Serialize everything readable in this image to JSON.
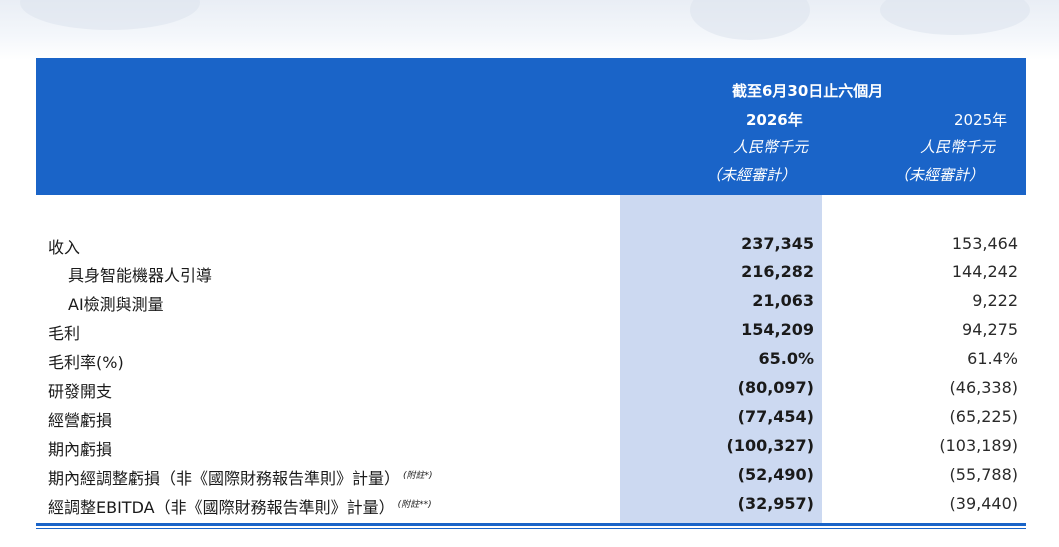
{
  "header": {
    "period": "截至6月30日止六個月",
    "col2026": {
      "year": "2026年",
      "currency": "人民幣千元",
      "audit": "（未經審計）"
    },
    "col2025": {
      "year": "2025年",
      "currency": "人民幣千元",
      "audit": "（未經審計）"
    }
  },
  "rows": [
    {
      "label": "收入",
      "v2026": "237,345",
      "v2025": "153,464"
    },
    {
      "label": "具身智能機器人引導",
      "v2026": "216,282",
      "v2025": "144,242"
    },
    {
      "label": "AI檢測與測量",
      "v2026": "21,063",
      "v2025": "9,222"
    },
    {
      "label": "毛利",
      "v2026": "154,209",
      "v2025": "94,275"
    },
    {
      "label": "毛利率(%)",
      "v2026": "65.0%",
      "v2025": "61.4%"
    },
    {
      "label": "研發開支",
      "v2026": "(80,097)",
      "v2025": "(46,338)"
    },
    {
      "label": "經營虧損",
      "v2026": "(77,454)",
      "v2025": "(65,225)"
    },
    {
      "label": "期內虧損",
      "v2026": "(100,327)",
      "v2025": "(103,189)"
    },
    {
      "label": "期內經調整虧損（非《國際財務報告準則》計量）",
      "note": "(附註*)",
      "v2026": "(52,490)",
      "v2025": "(55,788)"
    },
    {
      "label": "經調整EBITDA（非《國際財務報告準則》計量）",
      "note": "(附註**)",
      "v2026": "(32,957)",
      "v2025": "(39,440)"
    }
  ]
}
